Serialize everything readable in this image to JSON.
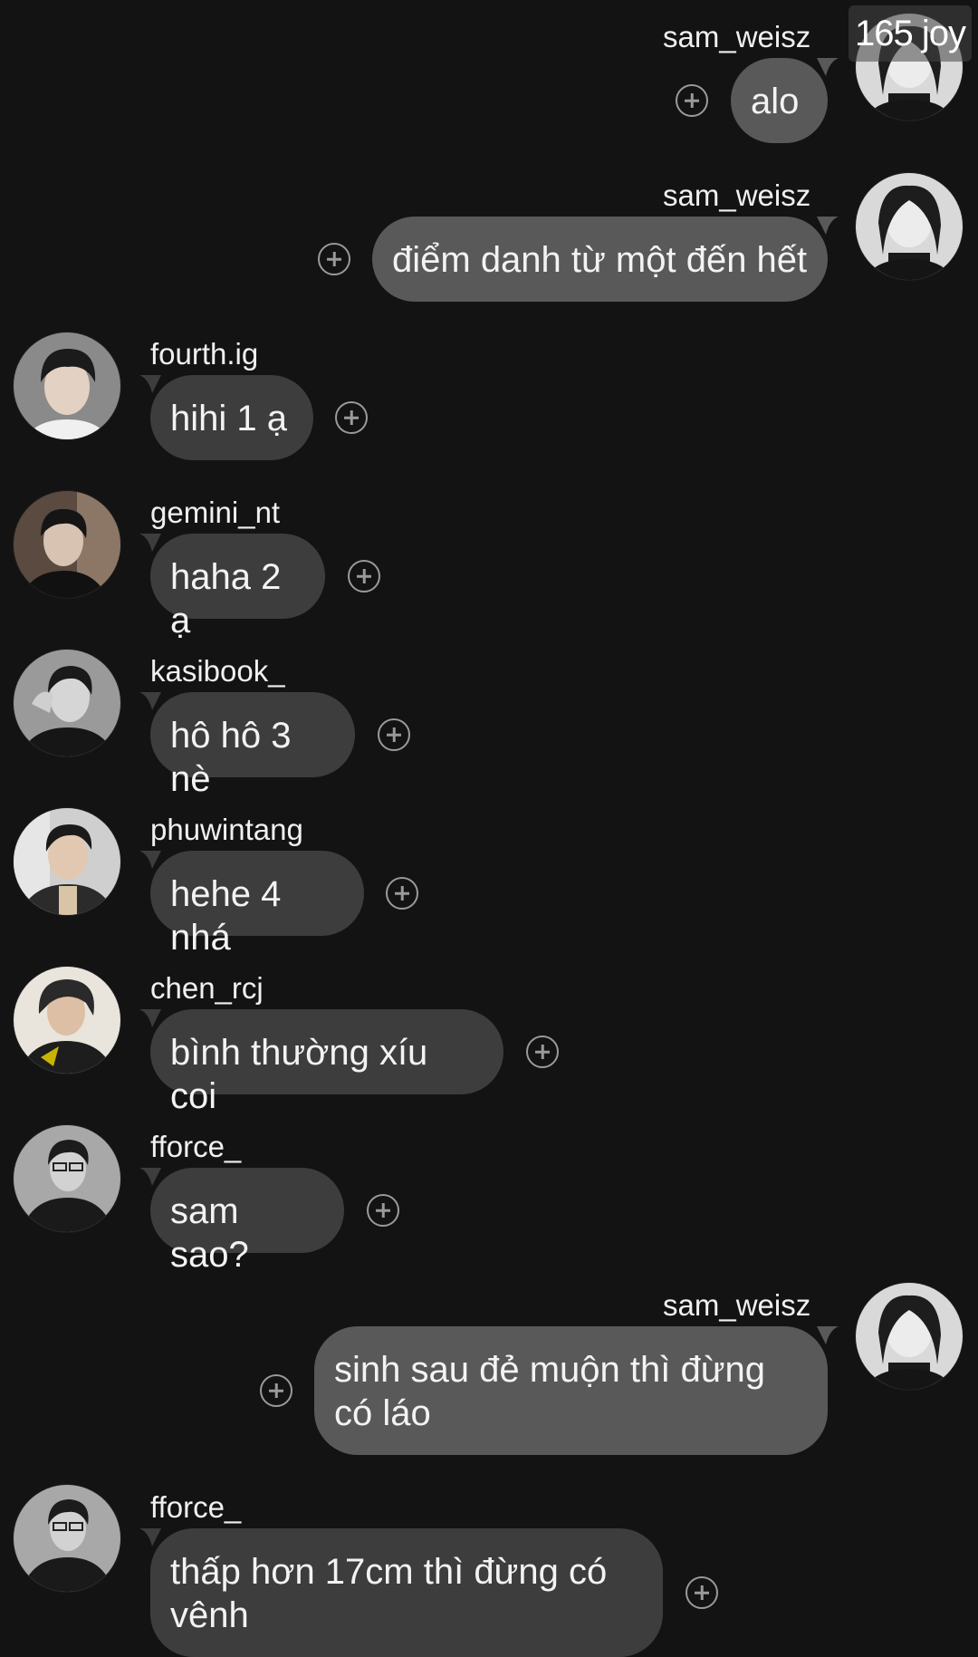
{
  "overlay_tag": "165 joy",
  "colors": {
    "background": "#131313",
    "incoming_bubble": "#3d3d3d",
    "outgoing_bubble": "#595959",
    "text": "#f3f3f3",
    "icon": "#9a9a9a"
  },
  "icons": {
    "react": "add-reaction-plus-icon",
    "avatar": "profile-avatar"
  },
  "messages": [
    {
      "user": "sam_weisz",
      "text": "alo",
      "self": true
    },
    {
      "user": "sam_weisz",
      "text": "điểm danh từ một đến hết",
      "self": true
    },
    {
      "user": "fourth.ig",
      "text": "hihi 1 ạ",
      "self": false
    },
    {
      "user": "gemini_nt",
      "text": "haha 2 ạ",
      "self": false
    },
    {
      "user": "kasibook_",
      "text": "hô hô 3 nè",
      "self": false
    },
    {
      "user": "phuwintang",
      "text": "hehe 4 nhá",
      "self": false
    },
    {
      "user": "chen_rcj",
      "text": "bình thường xíu coi",
      "self": false
    },
    {
      "user": "fforce_",
      "text": "sam sao?",
      "self": false
    },
    {
      "user": "sam_weisz",
      "text": "sinh sau đẻ muộn thì đừng\ncó láo",
      "self": true
    },
    {
      "user": "fforce_",
      "text": "thấp hơn 17cm thì đừng có\nvênh",
      "self": false
    }
  ]
}
